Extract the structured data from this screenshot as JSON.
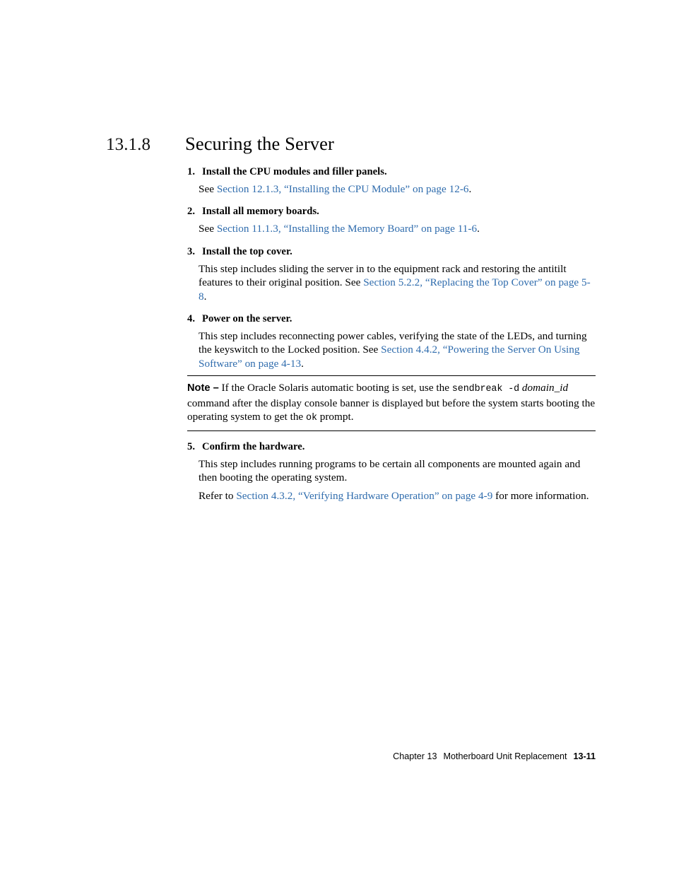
{
  "heading": {
    "number": "13.1.8",
    "title": "Securing the Server"
  },
  "steps": [
    {
      "marker": "1.",
      "title": "Install the CPU modules and filler panels.",
      "body_pre": "See ",
      "link": "Section 12.1.3, “Installing the CPU Module” on page 12-6",
      "body_post": "."
    },
    {
      "marker": "2.",
      "title": "Install all memory boards.",
      "body_pre": "See ",
      "link": "Section 11.1.3, “Installing the Memory Board” on page 11-6",
      "body_post": "."
    },
    {
      "marker": "3.",
      "title": "Install the top cover.",
      "body_pre": "This step includes sliding the server in to the equipment rack and restoring the antitilt features to their original position. See ",
      "link": "Section 5.2.2, “Replacing the Top Cover” on page 5-8",
      "body_post": "."
    },
    {
      "marker": "4.",
      "title": "Power on the server.",
      "body_pre": "This step includes reconnecting power cables, verifying the state of the LEDs, and turning the keyswitch to the Locked position. See ",
      "link": "Section 4.4.2, “Powering the Server On Using Software” on page 4-13",
      "body_post": "."
    }
  ],
  "note": {
    "label": "Note –",
    "text_1": " If the Oracle Solaris automatic booting is set, use the ",
    "code_1": "sendbreak  -d",
    "italic_1": "domain_id",
    "text_2": " command after the display console banner is displayed but before the system starts booting the operating system to get the ",
    "code_2": "ok",
    "text_3": " prompt."
  },
  "steps_after_note": [
    {
      "marker": "5.",
      "title": "Confirm the hardware.",
      "para_1": "This step includes running programs to be certain all components are mounted again and then booting the operating system.",
      "para_2_pre": "Refer to ",
      "link": "Section 4.3.2, “Verifying Hardware Operation” on page 4-9",
      "para_2_post": " for more information."
    }
  ],
  "footer": {
    "chapter": "Chapter 13",
    "section": "Motherboard Unit Replacement",
    "page_number": "13-11"
  },
  "colors": {
    "link": "#2f6cad",
    "text": "#000000",
    "background": "#ffffff"
  }
}
